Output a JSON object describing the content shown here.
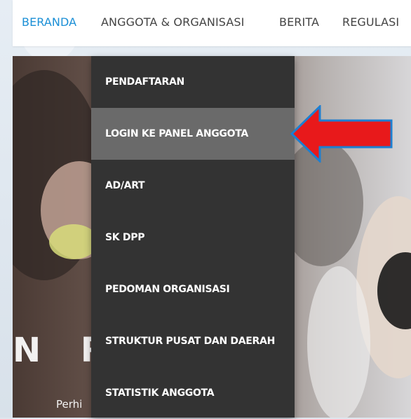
{
  "nav": {
    "items": [
      {
        "label": "BERANDA",
        "active": true
      },
      {
        "label": "ANGGOTA & ORGANISASI"
      },
      {
        "label": "BERITA"
      },
      {
        "label": "REGULASI"
      }
    ]
  },
  "hero": {
    "title": "N R        HER",
    "subtitle": "Perhi"
  },
  "dropdown": {
    "items": [
      {
        "label": "PENDAFTARAN"
      },
      {
        "label": "LOGIN KE PANEL ANGGOTA",
        "highlighted": true
      },
      {
        "label": "AD/ART"
      },
      {
        "label": "SK DPP"
      },
      {
        "label": "PEDOMAN ORGANISASI"
      },
      {
        "label": "STRUKTUR PUSAT DAN DAERAH"
      },
      {
        "label": "STATISTIK ANGGOTA"
      }
    ]
  },
  "annotation": {
    "arrow_color": "#e8191b",
    "arrow_border": "#1d7fd1",
    "points_to": "LOGIN KE PANEL ANGGOTA"
  },
  "colors": {
    "accent": "#1b8fd6",
    "nav_text": "#444444",
    "dropdown_bg": "#333333",
    "dropdown_highlight": "#6a6a6a"
  }
}
